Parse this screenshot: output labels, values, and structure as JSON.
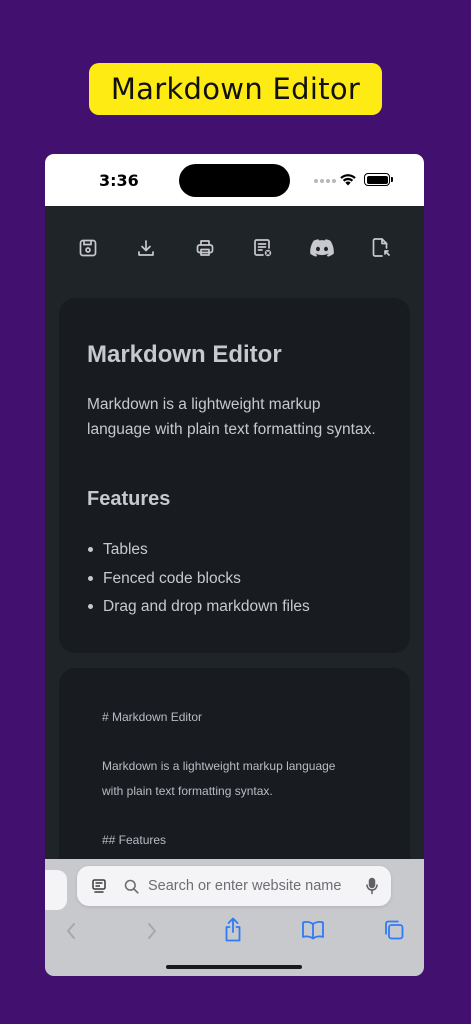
{
  "banner": {
    "title": "Markdown Editor"
  },
  "status_bar": {
    "time": "3:36"
  },
  "toolbar": {
    "icons": [
      "save-icon",
      "download-icon",
      "print-icon",
      "document-settings-icon",
      "discord-icon",
      "file-export-icon"
    ]
  },
  "preview": {
    "title": "Markdown Editor",
    "paragraph": "Markdown is a lightweight markup language with plain text formatting syntax.",
    "features_heading": "Features",
    "features": [
      "Tables",
      "Fenced code blocks",
      "Drag and drop markdown files"
    ]
  },
  "source": {
    "lines": [
      "# Markdown Editor",
      "Markdown is a lightweight markup language",
      "with plain text formatting syntax.",
      "## Features"
    ]
  },
  "browser": {
    "url_placeholder": "Search or enter website name"
  },
  "colors": {
    "background": "#42106f",
    "banner": "#ffeb14",
    "app_bg": "#1f2429",
    "card_bg": "#181c21",
    "text": "#c7c9cd",
    "safari_accent": "#2f7bf5"
  }
}
